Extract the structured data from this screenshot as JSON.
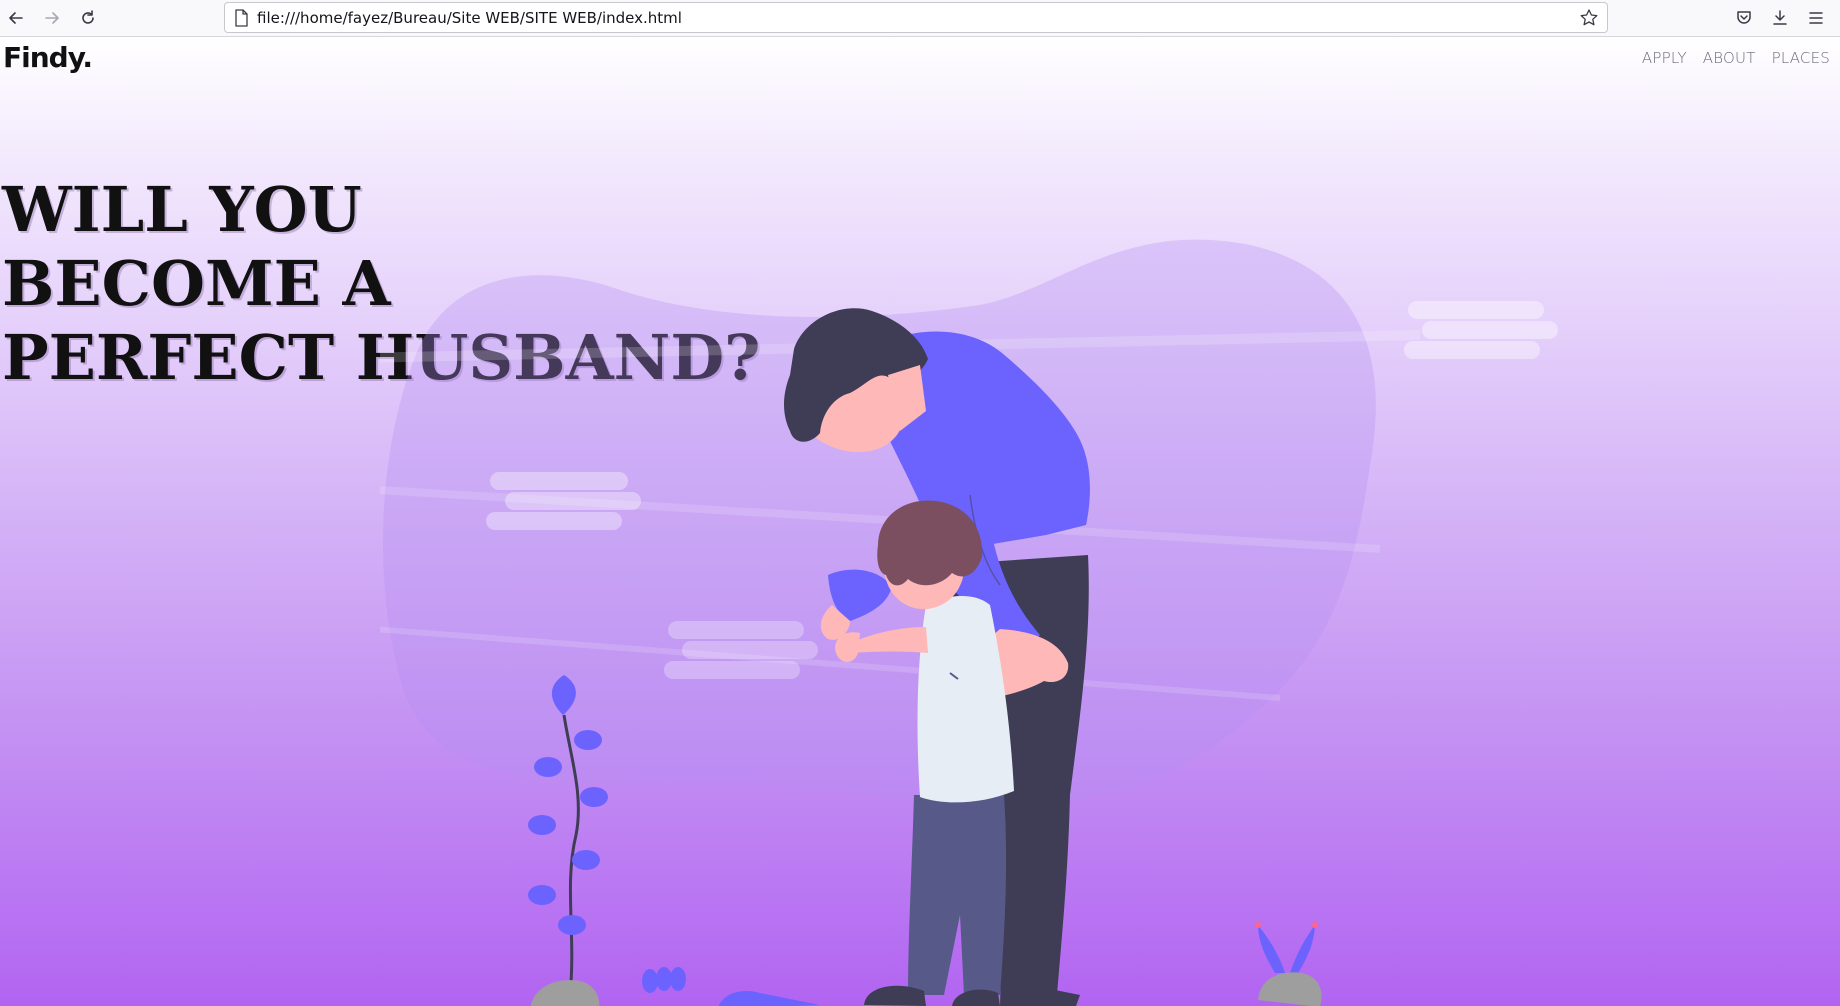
{
  "browser": {
    "url": "file:///home/fayez/Bureau/Site WEB/SITE WEB/index.html",
    "icons": [
      "back-icon",
      "forward-icon",
      "reload-icon",
      "page-icon",
      "bookmark-star-icon",
      "pocket-icon",
      "download-icon",
      "menu-icon"
    ]
  },
  "site": {
    "logo": "Findy.",
    "nav": [
      "APPLY",
      "ABOUT",
      "PLACES"
    ],
    "headline": [
      "WILL YOU",
      "BECOME A",
      "PERFECT HUSBAND?"
    ]
  },
  "colors": {
    "accent": "#6c63ff",
    "dark_figure": "#3f3d56",
    "gradient_top": "#ffffff",
    "gradient_bottom": "#b264f1"
  }
}
